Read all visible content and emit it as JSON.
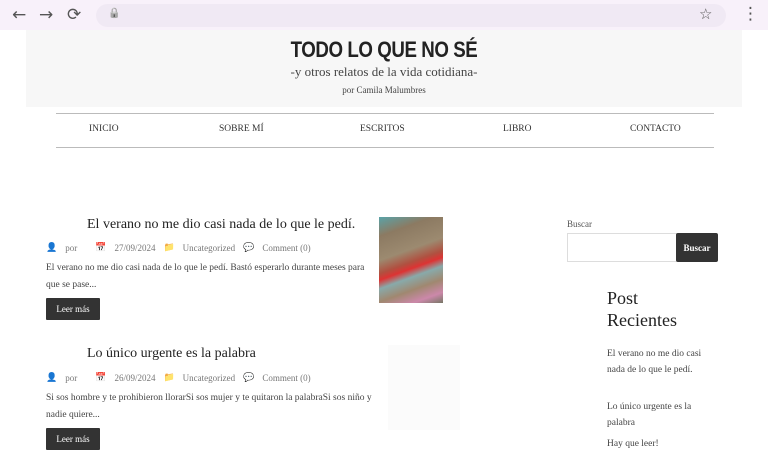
{
  "browser": {
    "back": "←",
    "forward": "→",
    "reload": "⟳",
    "lock": "🔒",
    "star": "☆",
    "menu": "⋮"
  },
  "site": {
    "title": "TODO LO QUE NO SÉ",
    "subtitle": "-y otros relatos de la vida cotidiana-",
    "byline": "por Camila Malumbres"
  },
  "menu": [
    "INICIO",
    "SOBRE MÍ",
    "ESCRITOS",
    "LIBRO",
    "CONTACTO"
  ],
  "posts": [
    {
      "title": "El verano no me dio casi nada de lo que le pedí.",
      "author": "por",
      "date": "27/09/2024",
      "category": "Uncategorized",
      "comments": "Comment (0)",
      "excerpt": "El verano no me dio casi nada de lo que le pedí. Bastó esperarlo durante meses para que se pase...",
      "button": "Leer más"
    },
    {
      "title": "Lo único urgente es la palabra",
      "author": "por",
      "date": "26/09/2024",
      "category": "Uncategorized",
      "comments": "Comment (0)",
      "excerpt": "Si sos hombre y te prohibieron llorarSi sos mujer y te quitaron la palabraSi sos niño y nadie quiere...",
      "button": "Leer más"
    }
  ],
  "sidebar": {
    "search_label": "Buscar",
    "search_value": "",
    "search_button": "Buscar",
    "recent_title": "Post Recientes",
    "recent": [
      "El verano no me dio casi nada de lo que le pedí.",
      "Lo único urgente es la palabra",
      "Hay que leer!"
    ]
  }
}
